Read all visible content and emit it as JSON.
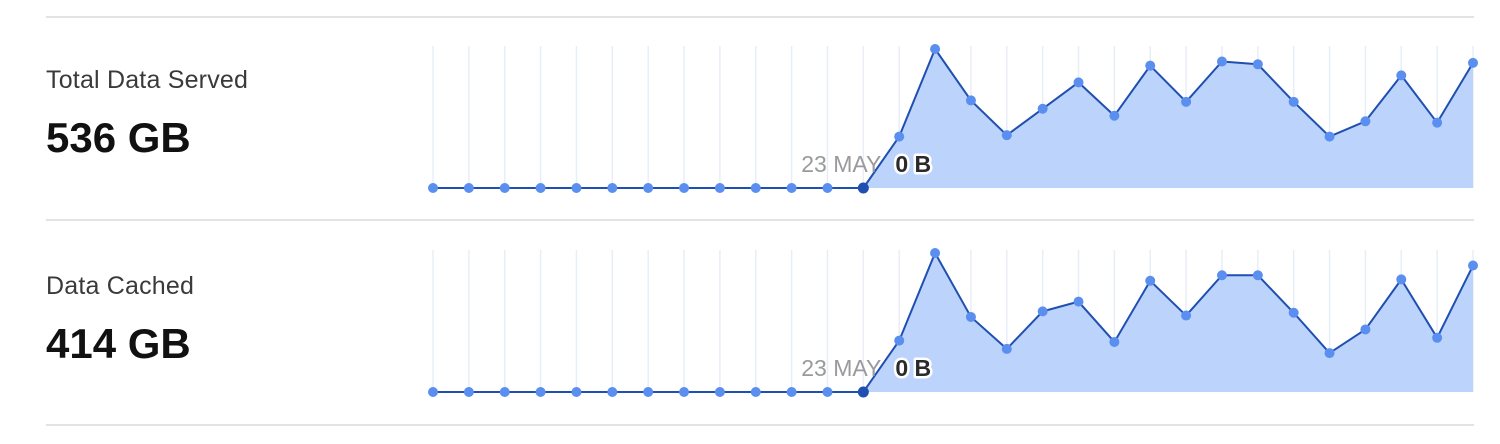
{
  "metrics": [
    {
      "label": "Total Data Served",
      "value": "536 GB"
    },
    {
      "label": "Data Cached",
      "value": "414 GB"
    }
  ],
  "colors": {
    "line": "#1f4fb0",
    "point": "#5a8ff0",
    "selected_point": "#1f4fb0",
    "fill": "#bcd4fb",
    "grid": "#e8eef8",
    "date_label": "#9a9a9e",
    "value_label": "#2a2a2c"
  },
  "chart_data": [
    {
      "type": "area",
      "selected_index": 12,
      "selected_date_label": "23 MAY",
      "selected_value_label": "0 B",
      "ylim": [
        0,
        100
      ],
      "values": [
        0,
        0,
        0,
        0,
        0,
        0,
        0,
        0,
        0,
        0,
        0,
        0,
        0,
        37,
        100,
        63,
        38,
        57,
        76,
        52,
        88,
        62,
        91,
        89,
        62,
        37,
        48,
        81,
        47,
        90
      ]
    },
    {
      "type": "area",
      "selected_index": 12,
      "selected_date_label": "23 MAY",
      "selected_value_label": "0 B",
      "ylim": [
        0,
        100
      ],
      "values": [
        0,
        0,
        0,
        0,
        0,
        0,
        0,
        0,
        0,
        0,
        0,
        0,
        0,
        37,
        100,
        54,
        31,
        58,
        65,
        36,
        80,
        55,
        84,
        84,
        57,
        28,
        45,
        81,
        39,
        91
      ]
    }
  ]
}
